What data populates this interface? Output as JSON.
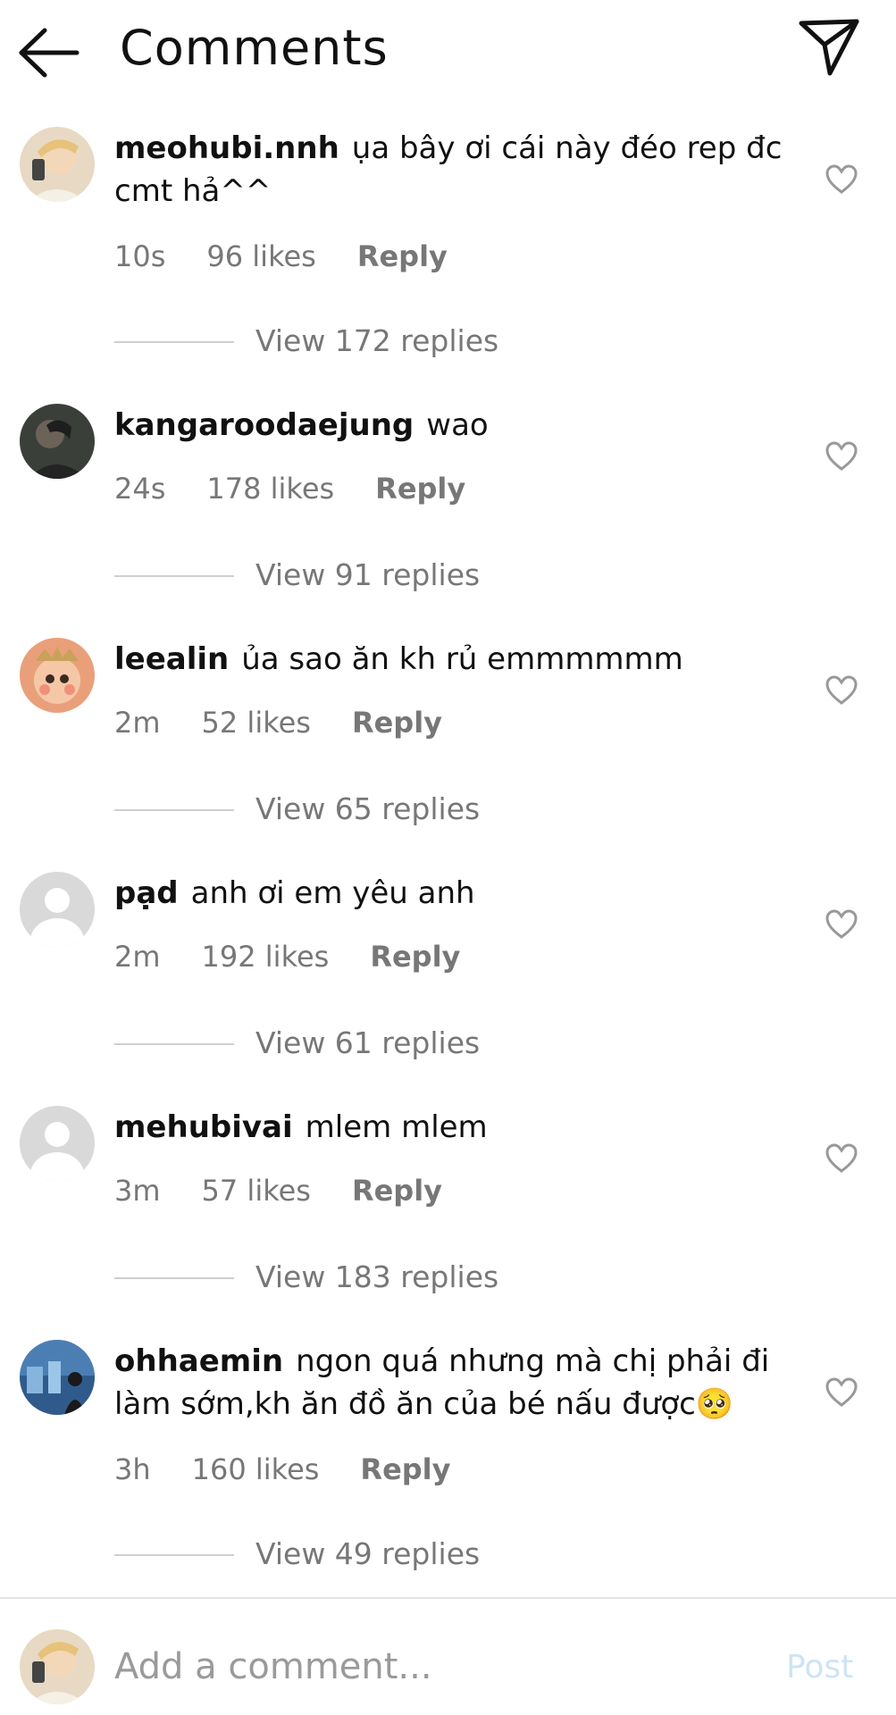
{
  "header": {
    "title": "Comments"
  },
  "comments": [
    {
      "username": "meohubi.nnh",
      "text": "ụa bây ơi cái này đéo rep đc cmt hả^^",
      "time": "10s",
      "likes": "96 likes",
      "reply": "Reply",
      "view_replies": "View 172 replies"
    },
    {
      "username": "kangaroodaejung",
      "text": "wao",
      "time": "24s",
      "likes": "178 likes",
      "reply": "Reply",
      "view_replies": "View 91 replies"
    },
    {
      "username": "leealin",
      "text": "ủa sao ăn kh rủ emmmmmm",
      "time": "2m",
      "likes": "52 likes",
      "reply": "Reply",
      "view_replies": "View 65 replies"
    },
    {
      "username": "pạd",
      "text": "anh ơi em yêu anh",
      "time": "2m",
      "likes": "192 likes",
      "reply": "Reply",
      "view_replies": "View 61 replies"
    },
    {
      "username": "mehubivai",
      "text": "mlem mlem",
      "time": "3m",
      "likes": "57 likes",
      "reply": "Reply",
      "view_replies": "View 183 replies"
    },
    {
      "username": "ohhaemin",
      "text": "ngon quá nhưng mà chị phải đi làm sớm,kh ăn đồ ăn của bé nấu được🥺",
      "time": "3h",
      "likes": "160 likes",
      "reply": "Reply",
      "view_replies": "View 49 replies"
    }
  ],
  "footer": {
    "placeholder": "Add a comment...",
    "post_label": "Post"
  },
  "colors": {
    "accent_post": "#cde4f6",
    "meta_text": "#777777"
  },
  "icons": [
    "back-arrow-icon",
    "send-icon",
    "heart-icon",
    "avatar-placeholder-icon"
  ]
}
